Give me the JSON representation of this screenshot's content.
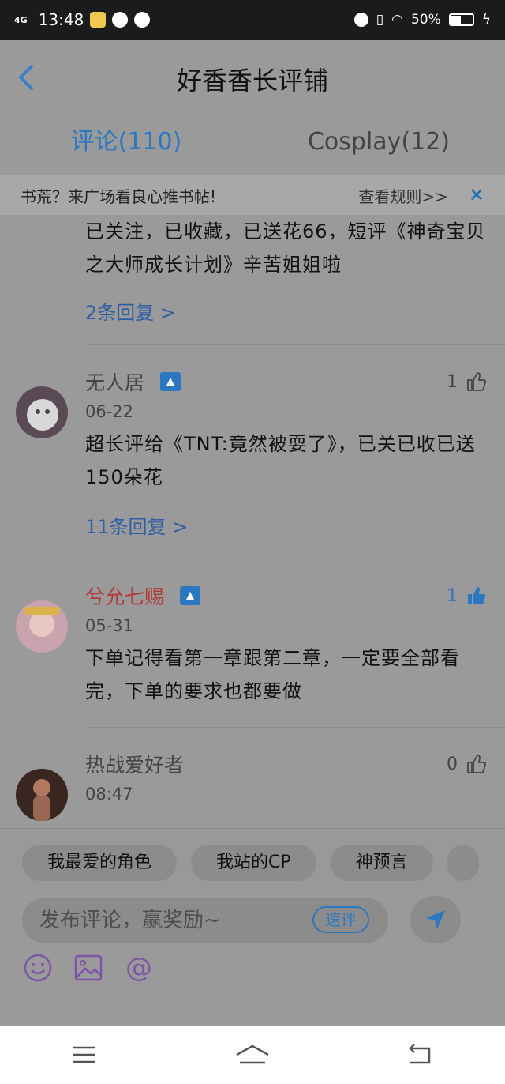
{
  "status_bar": {
    "network": "4G",
    "time": "13:48",
    "battery_percent": "50%"
  },
  "header": {
    "title": "好香香长评铺"
  },
  "tabs": [
    {
      "label": "评论(110)",
      "active": true
    },
    {
      "label": "Cosplay(12)",
      "active": false
    }
  ],
  "banner": {
    "text": "书荒？来广场看良心推书帖!",
    "rules_link": "查看规则>>"
  },
  "comments": [
    {
      "body": "已关注，已收藏，已送花66，短评《神奇宝贝之大师成长计划》辛苦姐姐啦",
      "replies": "2条回复 >"
    },
    {
      "username": "无人居",
      "date": "06-22",
      "likes": "1",
      "liked": false,
      "body": "超长评给《TNT:竟然被耍了》，已关已收已送150朵花",
      "replies": "11条回复 >"
    },
    {
      "username": "兮允七赐",
      "date": "05-31",
      "likes": "1",
      "liked": true,
      "body": "下单记得看第一章跟第二章，一定要全部看完，下单的要求也都要做"
    },
    {
      "username": "热战爱好者",
      "date": "08:47",
      "likes": "0",
      "liked": false
    }
  ],
  "chips": [
    "我最爱的角色",
    "我站的CP",
    "神预言"
  ],
  "input": {
    "placeholder": "发布评论，赢奖励~",
    "quick_label": "速评"
  },
  "colors": {
    "accent": "#2b78c2",
    "overlay_bg": "#9a9a9a"
  }
}
